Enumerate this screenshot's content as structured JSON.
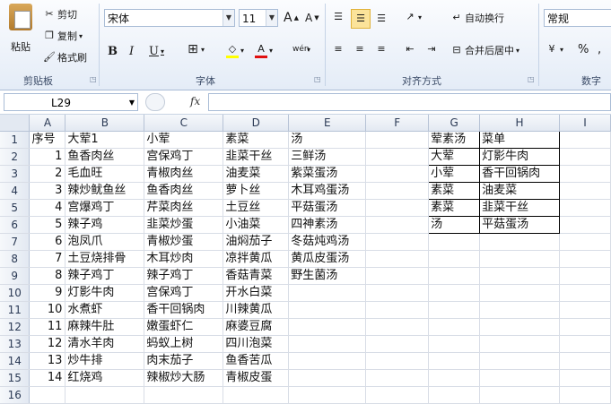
{
  "ribbon": {
    "clipboard": {
      "paste": "粘贴",
      "cut": "剪切",
      "copy": "复制",
      "format_painter": "格式刷",
      "group": "剪贴板"
    },
    "font": {
      "name": "宋体",
      "size": "11",
      "bold": "B",
      "italic": "I",
      "underline": "U",
      "group": "字体",
      "grow": "A",
      "shrink": "A"
    },
    "align": {
      "wrap": "自动换行",
      "merge": "合并后居中",
      "group": "对齐方式"
    },
    "number": {
      "format": "常规",
      "percent": "%",
      "group": "数字"
    }
  },
  "formula_bar": {
    "cell_ref": "L29",
    "fx": "fx",
    "content": ""
  },
  "columns": [
    "A",
    "B",
    "C",
    "D",
    "E",
    "F",
    "G",
    "H",
    "I"
  ],
  "rows": [
    {
      "n": "1",
      "A": "序号",
      "B": "大荤1",
      "C": "小荤",
      "D": "素菜",
      "E": "汤",
      "F": "",
      "G": "荤素汤",
      "H": "菜单"
    },
    {
      "n": "2",
      "A": "1",
      "B": "鱼香肉丝",
      "C": "宫保鸡丁",
      "D": "韭菜干丝",
      "E": "三鲜汤",
      "F": "",
      "G": "大荤",
      "H": "灯影牛肉"
    },
    {
      "n": "3",
      "A": "2",
      "B": "毛血旺",
      "C": "青椒肉丝",
      "D": "油麦菜",
      "E": "紫菜蛋汤",
      "F": "",
      "G": "小荤",
      "H": "香干回锅肉"
    },
    {
      "n": "4",
      "A": "3",
      "B": "辣炒鱿鱼丝",
      "C": "鱼香肉丝",
      "D": "萝卜丝",
      "E": "木耳鸡蛋汤",
      "F": "",
      "G": "素菜",
      "H": "油麦菜"
    },
    {
      "n": "5",
      "A": "4",
      "B": "宫爆鸡丁",
      "C": "芹菜肉丝",
      "D": "土豆丝",
      "E": "平菇蛋汤",
      "F": "",
      "G": "素菜",
      "H": "韭菜干丝"
    },
    {
      "n": "6",
      "A": "5",
      "B": "辣子鸡",
      "C": "韭菜炒蛋",
      "D": "小油菜",
      "E": "四神素汤",
      "F": "",
      "G": "汤",
      "H": "平菇蛋汤"
    },
    {
      "n": "7",
      "A": "6",
      "B": "泡凤爪",
      "C": "青椒炒蛋",
      "D": "油焖茄子",
      "E": "冬菇炖鸡汤",
      "F": "",
      "G": "",
      "H": ""
    },
    {
      "n": "8",
      "A": "7",
      "B": "土豆烧排骨",
      "C": "木耳炒肉",
      "D": "凉拌黄瓜",
      "E": "黄瓜皮蛋汤",
      "F": "",
      "G": "",
      "H": ""
    },
    {
      "n": "9",
      "A": "8",
      "B": "辣子鸡丁",
      "C": "辣子鸡丁",
      "D": "香菇青菜",
      "E": "野生菌汤",
      "F": "",
      "G": "",
      "H": ""
    },
    {
      "n": "10",
      "A": "9",
      "B": "灯影牛肉",
      "C": "宫保鸡丁",
      "D": "开水白菜",
      "E": "",
      "F": "",
      "G": "",
      "H": ""
    },
    {
      "n": "11",
      "A": "10",
      "B": "水煮虾",
      "C": "香干回锅肉",
      "D": "川辣黄瓜",
      "E": "",
      "F": "",
      "G": "",
      "H": ""
    },
    {
      "n": "12",
      "A": "11",
      "B": "麻辣牛肚",
      "C": "嫩蛋虾仁",
      "D": "麻婆豆腐",
      "E": "",
      "F": "",
      "G": "",
      "H": ""
    },
    {
      "n": "13",
      "A": "12",
      "B": "清水羊肉",
      "C": "蚂蚁上树",
      "D": "四川泡菜",
      "E": "",
      "F": "",
      "G": "",
      "H": ""
    },
    {
      "n": "14",
      "A": "13",
      "B": "炒牛排",
      "C": "肉末茄子",
      "D": "鱼香苦瓜",
      "E": "",
      "F": "",
      "G": "",
      "H": ""
    },
    {
      "n": "15",
      "A": "14",
      "B": "红烧鸡",
      "C": "辣椒炒大肠",
      "D": "青椒皮蛋",
      "E": "",
      "F": "",
      "G": "",
      "H": ""
    },
    {
      "n": "16",
      "A": "",
      "B": "",
      "C": "",
      "D": "",
      "E": "",
      "F": "",
      "G": "",
      "H": ""
    }
  ],
  "colors": {
    "accent": "#fbe39a",
    "header_bg": "#e3e9f2",
    "ribbon_bg": "#e4ecf7"
  }
}
